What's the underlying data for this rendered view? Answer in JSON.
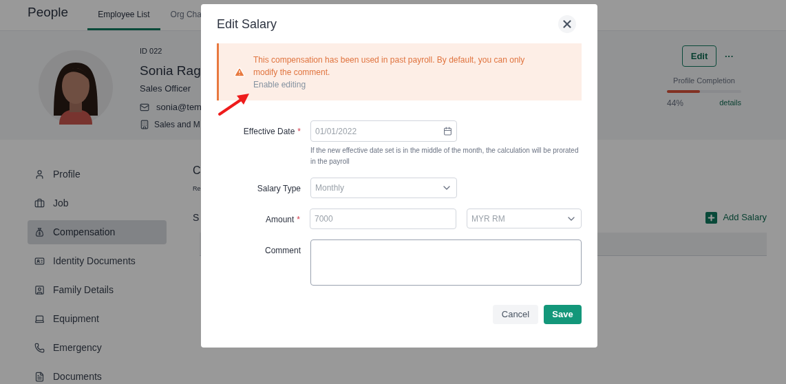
{
  "app": {
    "title": "People"
  },
  "tabs": [
    {
      "label": "Employee List",
      "selected": true
    },
    {
      "label": "Org Cha",
      "selected": false
    }
  ],
  "employee": {
    "id": "ID 022",
    "name": "Sonia Rag",
    "position": "Sales Officer",
    "email": "sonia@tem",
    "department": "Sales and M"
  },
  "actions": {
    "edit": "Edit",
    "more": "···"
  },
  "profile_completion": {
    "label": "Profile Completion",
    "level": 0.44,
    "percent": "44%",
    "link": "details"
  },
  "sidebar": {
    "items": [
      {
        "label": "Profile",
        "selected": false
      },
      {
        "label": "Job",
        "selected": false
      },
      {
        "label": "Compensation",
        "selected": true
      },
      {
        "label": "Identity Documents",
        "selected": false
      },
      {
        "label": "Family Details",
        "selected": false
      },
      {
        "label": "Equipment",
        "selected": false
      },
      {
        "label": "Emergency",
        "selected": false
      },
      {
        "label": "Documents",
        "selected": false
      }
    ]
  },
  "section": {
    "title": "C",
    "subtitle": "Re",
    "subheading": "S",
    "add_button": "Add Salary"
  },
  "dialog": {
    "title": "Edit Salary",
    "alert": {
      "message": "This compensation has been used in past payroll. By default, you can only modify the comment.",
      "link": "Enable editing"
    },
    "required_mark": "*",
    "fields": [
      {
        "kind": "date",
        "label": "Effective Date",
        "required": true,
        "disabled": true,
        "value": "01/01/2022",
        "hint": "If the new effective date set is in the middle of the month, the calculation will be prorated in the payroll"
      },
      {
        "kind": "select",
        "label": "Salary Type",
        "required": false,
        "disabled": true,
        "value": "Monthly"
      },
      {
        "kind": "amount",
        "label": "Amount",
        "required": true,
        "disabled": true,
        "value": "7000",
        "currency": "MYR RM"
      },
      {
        "kind": "textarea",
        "label": "Comment",
        "required": false,
        "disabled": false
      }
    ],
    "buttons": {
      "cancel": "Cancel",
      "save": "Save"
    }
  }
}
